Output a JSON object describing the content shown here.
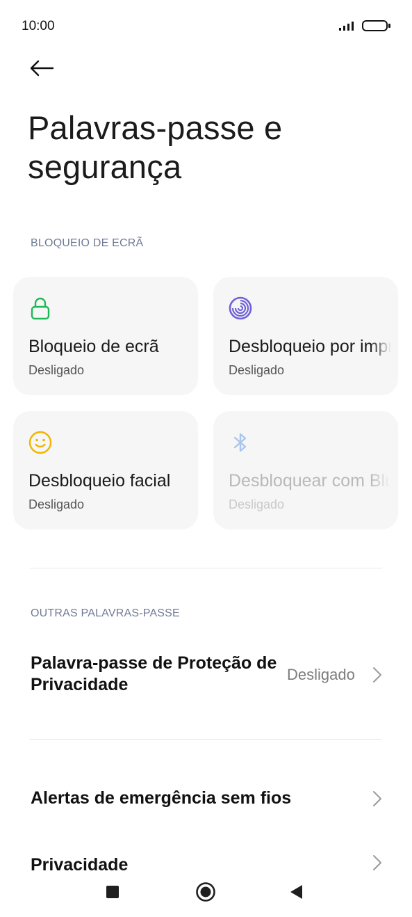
{
  "status_bar": {
    "time": "10:00"
  },
  "header": {
    "title": "Palavras-passe e segurança"
  },
  "sections": {
    "screen_lock": "BLOQUEIO DE ECRÃ",
    "other_passwords": "OUTRAS PALAVRAS-PASSE"
  },
  "cards": [
    {
      "title": "Bloqueio de ecrã",
      "status": "Desligado",
      "icon": "lock-icon",
      "color": "#1db954"
    },
    {
      "title": "Desbloqueio por impressão digital",
      "status": "Desligado",
      "icon": "fingerprint-icon",
      "color": "#6e61d8"
    },
    {
      "title": "Desbloqueio facial",
      "status": "Desligado",
      "icon": "face-icon",
      "color": "#f1b400"
    },
    {
      "title": "Desbloquear com Bluetooth",
      "status": "Desligado",
      "icon": "bluetooth-icon",
      "color": "#a9c6ef"
    }
  ],
  "rows": {
    "privacy_password": {
      "title": "Palavra-passe de Proteção de Privacidade",
      "value": "Desligado"
    },
    "emergency_alerts": {
      "title": "Alertas de emergência sem fios"
    },
    "privacy": {
      "title": "Privacidade"
    }
  },
  "nav": {
    "buttons": [
      "recents-button",
      "home-button",
      "back-button"
    ]
  }
}
